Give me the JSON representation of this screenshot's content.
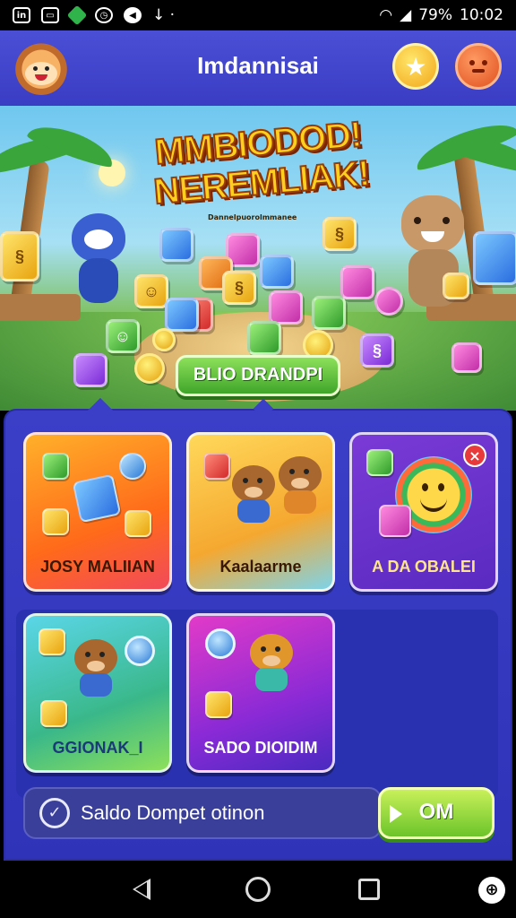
{
  "status_bar": {
    "battery": "79%",
    "time": "10:02"
  },
  "header": {
    "title": "Imdannisai"
  },
  "banner": {
    "title_line1": "MMBIODOD!",
    "title_line2": "NEREMLIAK!",
    "subtitle": "Dannelpuorolmmanee",
    "button_label": "BLIO DRANDPI"
  },
  "cards": [
    {
      "label": "JOSY MALIIAN"
    },
    {
      "label": "Kaalaarme"
    },
    {
      "label": "A DA OBALEI"
    },
    {
      "label": "GGIONAK_I"
    },
    {
      "label": "SADO DIOIDIM"
    }
  ],
  "daily": {
    "text": "Saldo Dompet otinon",
    "button_label": "OM"
  },
  "colors": {
    "header": "#4a4fd6",
    "panel": "#3b3fc8",
    "accent_green": "#6cc42a",
    "accent_yellow": "#ffcf1f"
  }
}
